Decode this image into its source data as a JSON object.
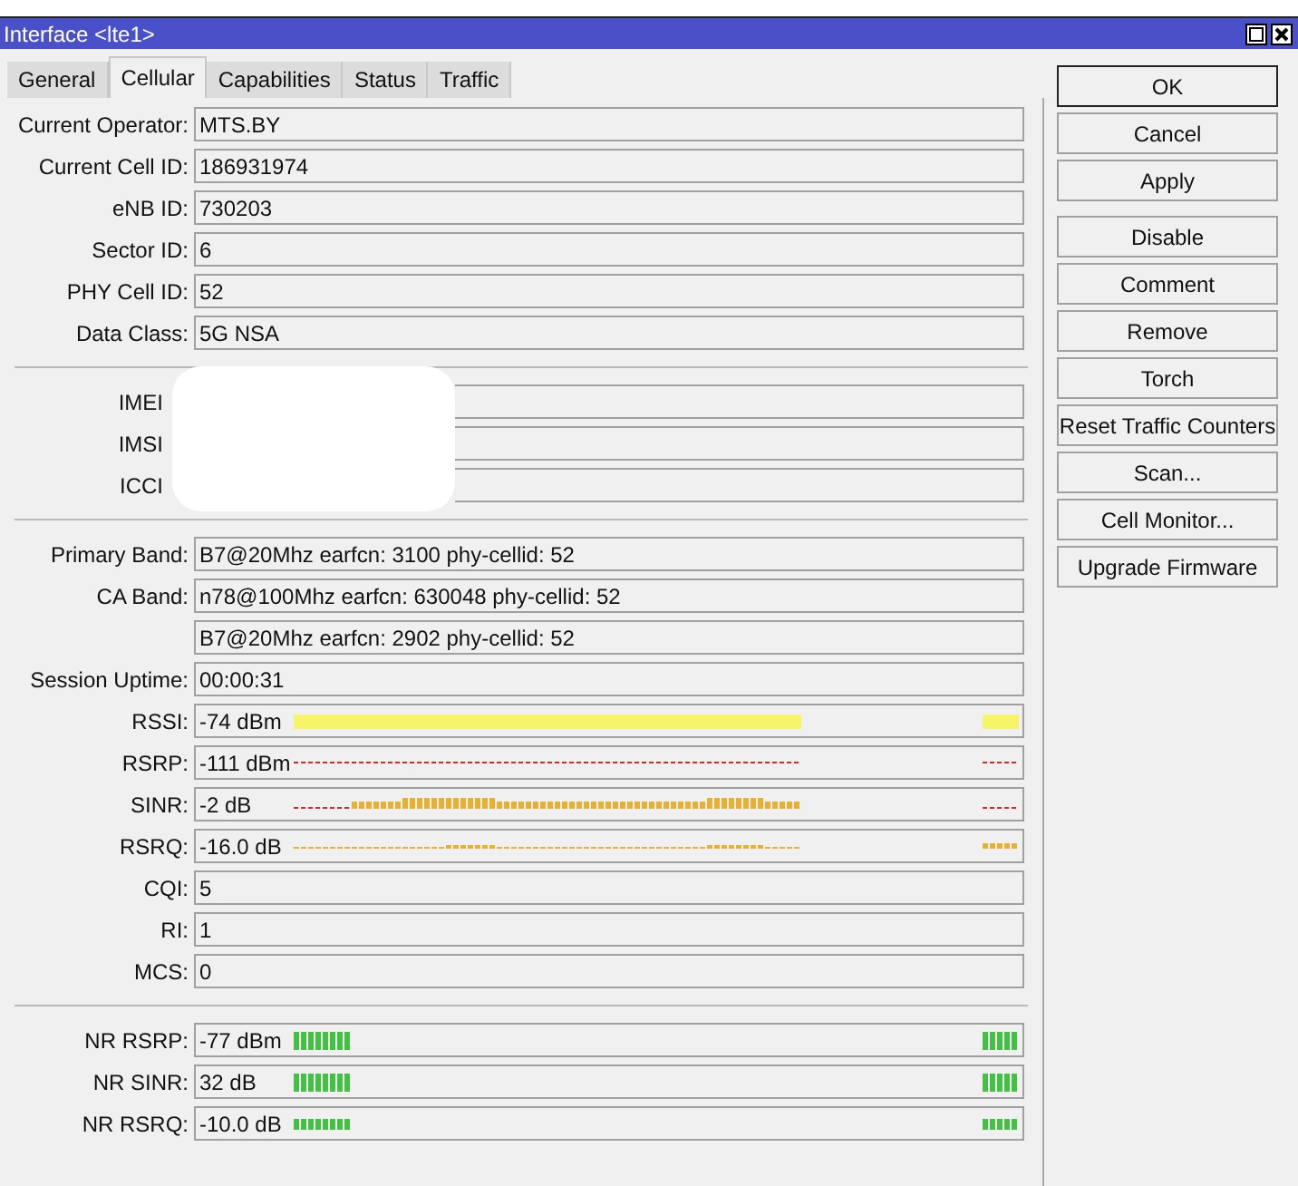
{
  "window": {
    "title": "Interface <lte1>"
  },
  "tabs": [
    {
      "label": "General",
      "selected": false
    },
    {
      "label": "Cellular",
      "selected": true
    },
    {
      "label": "Capabilities",
      "selected": false
    },
    {
      "label": "Status",
      "selected": false
    },
    {
      "label": "Traffic",
      "selected": false
    }
  ],
  "sections": [
    {
      "kind": "plain",
      "rows": [
        {
          "label": "Current Operator:",
          "value": "MTS.BY",
          "kind": "plain"
        },
        {
          "label": "Current Cell ID:",
          "value": "186931974",
          "kind": "plain"
        },
        {
          "label": "eNB ID:",
          "value": "730203",
          "kind": "plain"
        },
        {
          "label": "Sector ID:",
          "value": "6",
          "kind": "plain"
        },
        {
          "label": "PHY Cell ID:",
          "value": "52",
          "kind": "plain"
        },
        {
          "label": "Data Class:",
          "value": "5G NSA",
          "kind": "plain"
        }
      ]
    },
    {
      "kind": "redacted",
      "rows": [
        {
          "label": "IMEI"
        },
        {
          "label": "IMSI"
        },
        {
          "label": "ICCI"
        }
      ]
    },
    {
      "kind": "plain",
      "rows": [
        {
          "label": "Primary Band:",
          "value": "B7@20Mhz earfcn: 3100 phy-cellid: 52",
          "kind": "plain"
        },
        {
          "label": "CA Band:",
          "value": "n78@100Mhz earfcn: 630048 phy-cellid: 52",
          "kind": "plain"
        },
        {
          "value": "B7@20Mhz earfcn: 2902 phy-cellid: 52",
          "kind": "plain"
        },
        {
          "label": "Session Uptime:",
          "value": "00:00:31",
          "kind": "plain"
        },
        {
          "label": "RSSI:",
          "value": "-74 dBm",
          "kind": "solid"
        },
        {
          "label": "RSRP:",
          "value": "-111 dBm",
          "kind": "dashed"
        },
        {
          "label": "SINR:",
          "value": "-2 dB",
          "kind": "mixed"
        },
        {
          "label": "RSRQ:",
          "value": "-16.0 dB",
          "kind": "dotted"
        },
        {
          "label": "CQI:",
          "value": "5",
          "kind": "plain"
        },
        {
          "label": "RI:",
          "value": "1",
          "kind": "plain"
        },
        {
          "label": "MCS:",
          "value": "0",
          "kind": "plain"
        }
      ]
    },
    {
      "kind": "plain",
      "rows": [
        {
          "label": "NR RSRP:",
          "value": "-77 dBm",
          "kind": "blocks"
        },
        {
          "label": "NR SINR:",
          "value": "32 dB",
          "kind": "blocks"
        },
        {
          "label": "NR RSRQ:",
          "value": "-10.0 dB",
          "kind": "ticks"
        }
      ]
    }
  ],
  "buttons": [
    {
      "label": "OK",
      "default": true
    },
    {
      "label": "Cancel",
      "default": false
    },
    {
      "label": "Apply",
      "default": false
    },
    {
      "label": "Disable",
      "default": false
    },
    {
      "label": "Comment",
      "default": false
    },
    {
      "label": "Remove",
      "default": false
    },
    {
      "label": "Torch",
      "default": false
    },
    {
      "label": "Reset Traffic Counters",
      "default": false
    },
    {
      "label": "Scan...",
      "default": false
    },
    {
      "label": "Cell Monitor...",
      "default": false
    },
    {
      "label": "Upgrade Firmware",
      "default": false
    }
  ]
}
